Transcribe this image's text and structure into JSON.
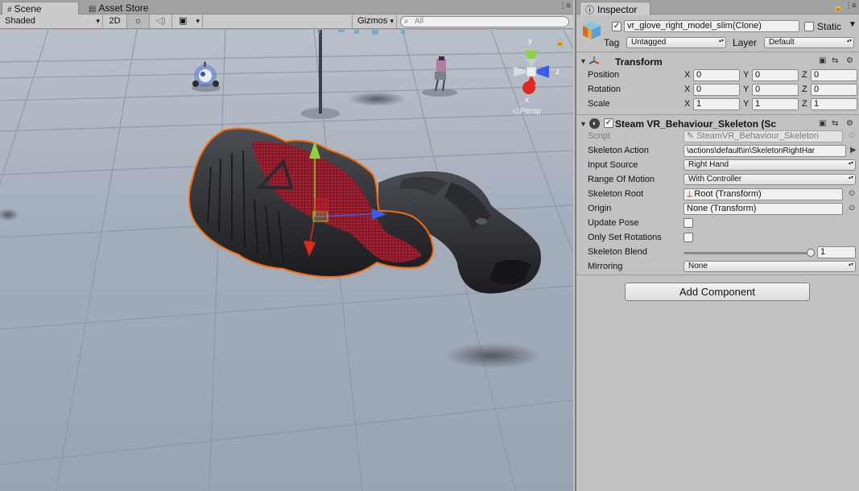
{
  "scene": {
    "tabs": [
      {
        "label": "Scene",
        "icon": "hash-icon",
        "active": true
      },
      {
        "label": "Asset Store",
        "icon": "store-icon",
        "active": false
      }
    ],
    "toolbar": {
      "shading_mode": "Shaded",
      "mode_2d": "2D",
      "gizmos": "Gizmos",
      "search_placeholder": "All"
    },
    "gizmo": {
      "y_label": "y",
      "z_label": "z",
      "x_label": "x",
      "projection": "Persp"
    }
  },
  "inspector": {
    "tab_label": "Inspector",
    "object": {
      "name": "vr_glove_right_model_slim(Clone)",
      "active": true,
      "static_label": "Static",
      "static": false,
      "tag_label": "Tag",
      "tag": "Untagged",
      "layer_label": "Layer",
      "layer": "Default"
    },
    "transform": {
      "title": "Transform",
      "rows": [
        {
          "label": "Position",
          "x": "0",
          "y": "0",
          "z": "0"
        },
        {
          "label": "Rotation",
          "x": "0",
          "y": "0",
          "z": "0"
        },
        {
          "label": "Scale",
          "x": "1",
          "y": "1",
          "z": "1"
        }
      ],
      "axis_x": "X",
      "axis_y": "Y",
      "axis_z": "Z"
    },
    "skeleton": {
      "title": "Steam VR_Behaviour_Skeleton (Sc",
      "enabled": true,
      "script_label": "Script",
      "script_value": "SteamVR_Behaviour_Skeleton",
      "action_label": "Skeleton Action",
      "action_value": "\\actions\\default\\in\\SkeletonRightHar",
      "input_label": "Input Source",
      "input_value": "Right Hand",
      "range_label": "Range Of Motion",
      "range_value": "With Controller",
      "root_label": "Skeleton Root",
      "root_value": "Root (Transform)",
      "origin_label": "Origin",
      "origin_value": "None (Transform)",
      "update_label": "Update Pose",
      "update_checked": false,
      "only_rot_label": "Only Set Rotations",
      "only_rot_checked": false,
      "blend_label": "Skeleton Blend",
      "blend_value": "1",
      "blend_fraction": 1.0,
      "mirror_label": "Mirroring",
      "mirror_value": "None"
    },
    "add_component": "Add Component"
  },
  "colors": {
    "selection_outline": "#ff6a00",
    "gizmo_y": "#8dd43c",
    "gizmo_x": "#e0281c",
    "gizmo_z": "#3a5cf0"
  }
}
